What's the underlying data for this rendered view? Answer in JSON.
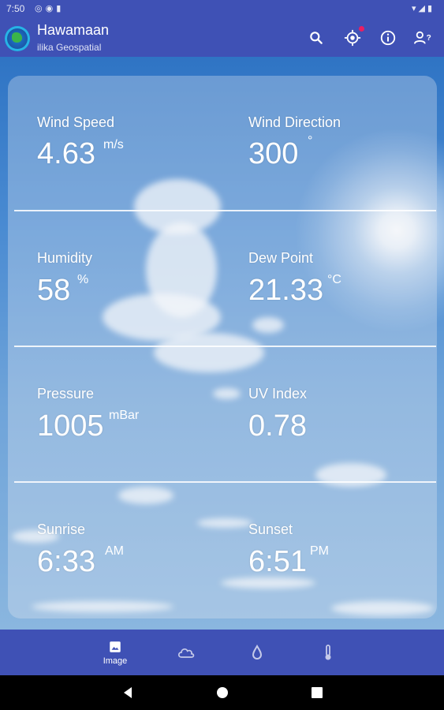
{
  "status_bar": {
    "time": "7:50",
    "left_icons": [
      "notification-icon",
      "photo-icon",
      "sd-card-icon"
    ],
    "right_icons": [
      "wifi-icon",
      "signal-icon",
      "battery-icon"
    ]
  },
  "app_bar": {
    "title": "Hawamaan",
    "subtitle": "ilika Geospatial",
    "actions": [
      "search-icon",
      "my-location-icon",
      "info-icon",
      "account-help-icon"
    ]
  },
  "metrics": [
    {
      "label": "Wind Speed",
      "value": "4.63",
      "unit": "m/s"
    },
    {
      "label": "Wind Direction",
      "value": "300",
      "unit": "°"
    },
    {
      "label": "Humidity",
      "value": "58",
      "unit": "%"
    },
    {
      "label": "Dew Point",
      "value": "21.33",
      "unit": "°C"
    },
    {
      "label": "Pressure",
      "value": "1005",
      "unit": "mBar"
    },
    {
      "label": "UV Index",
      "value": "0.78",
      "unit": ""
    },
    {
      "label": "Sunrise",
      "value": "6:33",
      "unit": "AM"
    },
    {
      "label": "Sunset",
      "value": "6:51",
      "unit": "PM"
    }
  ],
  "bottom_nav": {
    "items": [
      {
        "label": "Image",
        "icon": "image-icon",
        "active": true
      },
      {
        "label": "",
        "icon": "cloud-icon",
        "active": false
      },
      {
        "label": "",
        "icon": "water-drop-icon",
        "active": false
      },
      {
        "label": "",
        "icon": "thermometer-icon",
        "active": false
      }
    ]
  },
  "colors": {
    "primary": "#3f51b5",
    "badge": "#e91e63"
  }
}
